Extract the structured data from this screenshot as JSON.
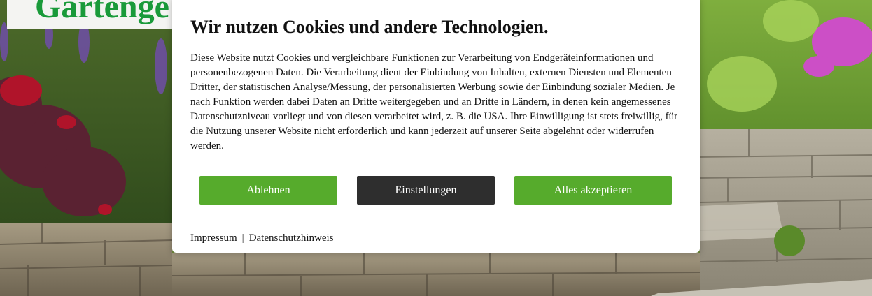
{
  "site": {
    "title": "Gartenge"
  },
  "cookie_banner": {
    "title": "Wir nutzen Cookies und andere Technologien.",
    "body": "Diese Website nutzt Cookies und vergleichbare Funktionen zur Verarbeitung von Endgeräteinformationen und personenbezogenen Daten. Die Verarbeitung dient der Einbindung von Inhalten, externen Diensten und Elementen Dritter, der statistischen Analyse/Messung, der personalisierten Werbung sowie der Einbindung sozialer Medien. Je nach Funktion werden dabei Daten an Dritte weitergegeben und an Dritte in Ländern, in denen kein angemessenes Datenschutzniveau vorliegt und von diesen verarbeitet wird, z. B. die USA. Ihre Einwilligung ist stets freiwillig, für die Nutzung unserer Website nicht erforderlich und kann jederzeit auf unserer Seite abgelehnt oder widerrufen werden.",
    "buttons": {
      "reject": "Ablehnen",
      "settings": "Einstellungen",
      "accept_all": "Alles akzeptieren"
    },
    "links": {
      "imprint": "Impressum",
      "separator": "|",
      "privacy": "Datenschutzhinweis"
    }
  },
  "colors": {
    "accent_green": "#56ab2c",
    "dark_button": "#2e2e2e",
    "title_green": "#1a9a3a"
  }
}
